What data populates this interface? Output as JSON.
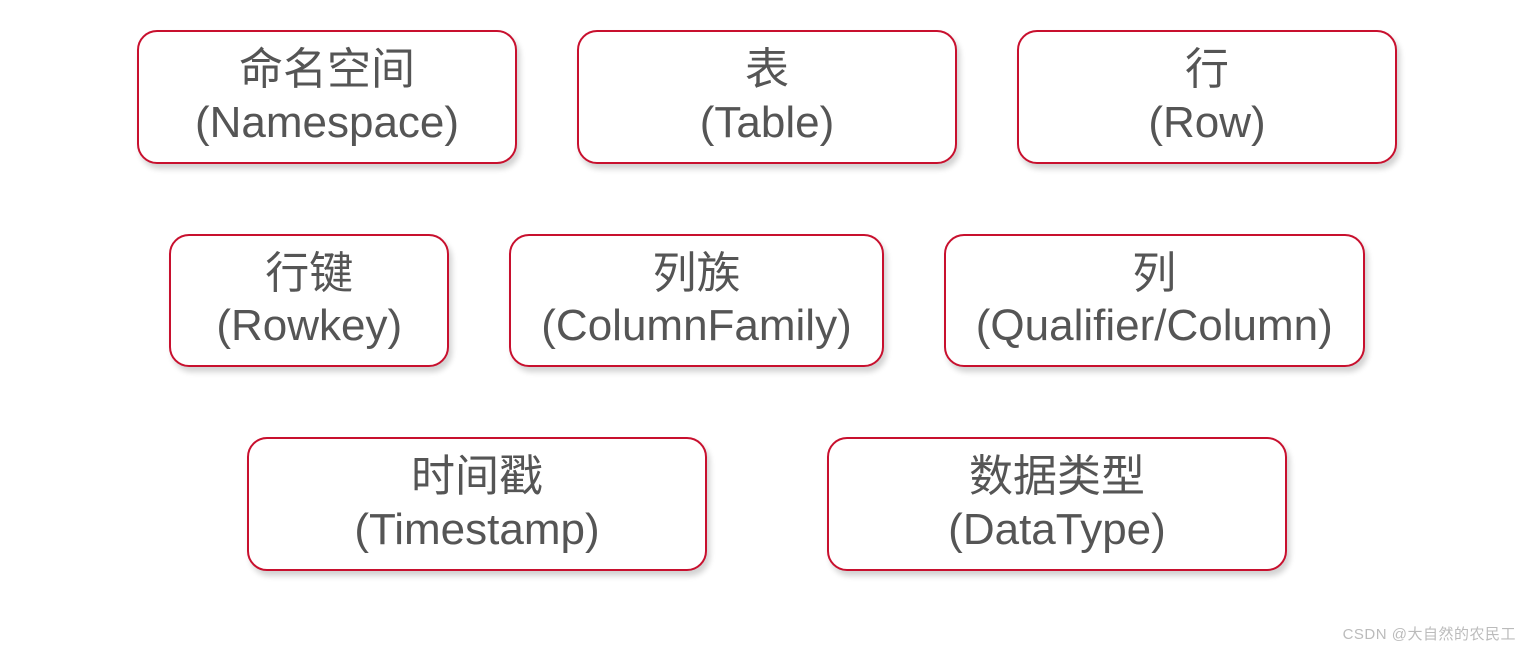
{
  "rows": [
    {
      "items": [
        {
          "cn": "命名空间",
          "en": "(Namespace)"
        },
        {
          "cn": "表",
          "en": "(Table)"
        },
        {
          "cn": "行",
          "en": "(Row)"
        }
      ]
    },
    {
      "items": [
        {
          "cn": "行键",
          "en": "(Rowkey)"
        },
        {
          "cn": "列族",
          "en": "(ColumnFamily)"
        },
        {
          "cn": "列",
          "en": "(Qualifier/Column)"
        }
      ]
    },
    {
      "items": [
        {
          "cn": "时间戳",
          "en": "(Timestamp)"
        },
        {
          "cn": "数据类型",
          "en": "(DataType)"
        }
      ]
    }
  ],
  "watermark": "CSDN @大自然的农民工"
}
